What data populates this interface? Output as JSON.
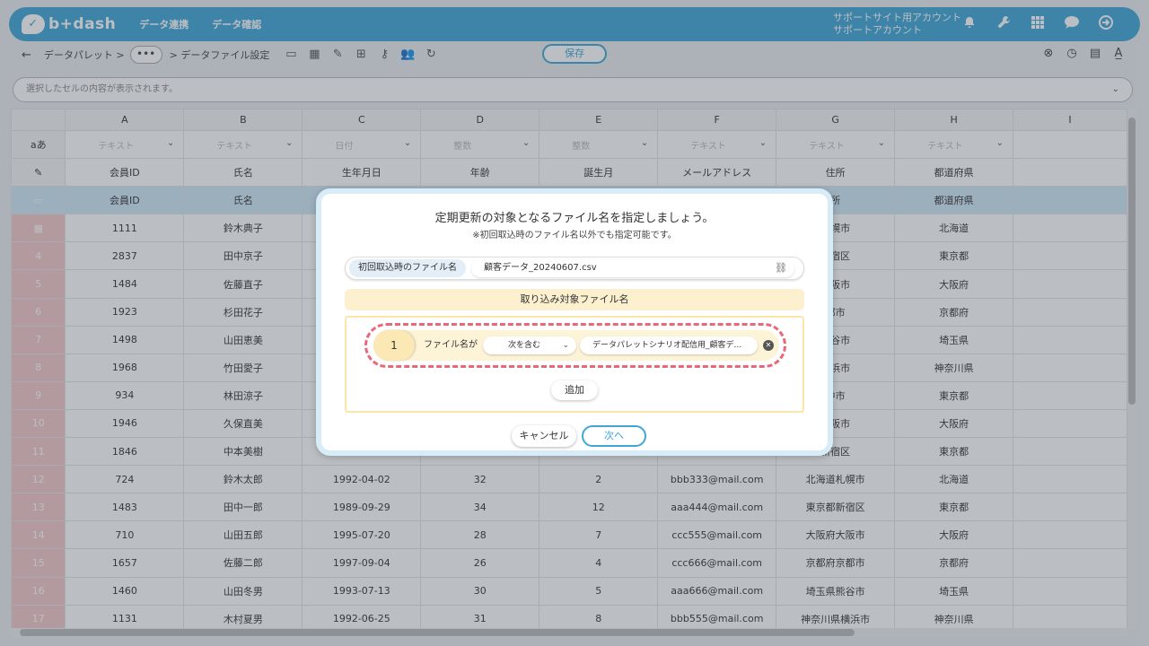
{
  "header": {
    "logo_text": "b+dash",
    "nav": [
      "データ連携",
      "データ確認"
    ],
    "account_line1": "サポートサイト用アカウント",
    "account_line2": "サポートアカウント",
    "icons": [
      "bell-icon",
      "wrench-icon",
      "grid-icon",
      "chat-icon",
      "logout-icon"
    ]
  },
  "toolbar": {
    "back": "←",
    "crumb1": "データパレット >",
    "dots": "•••",
    "crumb2": "> データファイル設定",
    "save_label": "保存"
  },
  "cellbar": {
    "placeholder": "選択したセルの内容が表示されます。"
  },
  "grid": {
    "corner_type": "aあ",
    "columns": [
      "A",
      "B",
      "C",
      "D",
      "E",
      "F",
      "G",
      "H",
      "I"
    ],
    "types": [
      "テキスト",
      "テキスト",
      "日付",
      "整数",
      "整数",
      "テキスト",
      "テキスト",
      "テキスト",
      ""
    ],
    "header_row": [
      "会員ID",
      "氏名",
      "生年月日",
      "年齢",
      "誕生月",
      "メールアドレス",
      "住所",
      "都道府県",
      ""
    ],
    "rows": [
      {
        "n": "",
        "cells": [
          "会員ID",
          "氏名",
          "",
          "",
          "",
          "",
          "所",
          "都道府県",
          ""
        ]
      },
      {
        "n": "",
        "cells": [
          "1111",
          "鈴木典子",
          "",
          "",
          "",
          "",
          "札幌市",
          "北海道",
          ""
        ]
      },
      {
        "n": "4",
        "cells": [
          "2837",
          "田中京子",
          "",
          "",
          "",
          "",
          "新宿区",
          "東京都",
          ""
        ]
      },
      {
        "n": "5",
        "cells": [
          "1484",
          "佐藤直子",
          "",
          "",
          "",
          "",
          "大阪市",
          "大阪府",
          ""
        ]
      },
      {
        "n": "6",
        "cells": [
          "1923",
          "杉田花子",
          "",
          "",
          "",
          "",
          "都市",
          "京都府",
          ""
        ]
      },
      {
        "n": "7",
        "cells": [
          "1498",
          "山田恵美",
          "",
          "",
          "",
          "",
          "熊谷市",
          "埼玉県",
          ""
        ]
      },
      {
        "n": "8",
        "cells": [
          "1968",
          "竹田愛子",
          "",
          "",
          "",
          "",
          "横浜市",
          "神奈川県",
          ""
        ]
      },
      {
        "n": "9",
        "cells": [
          "934",
          "林田涼子",
          "",
          "",
          "",
          "",
          "中市",
          "東京都",
          ""
        ]
      },
      {
        "n": "10",
        "cells": [
          "1946",
          "久保直美",
          "",
          "",
          "",
          "",
          "大阪市",
          "大阪府",
          ""
        ]
      },
      {
        "n": "11",
        "cells": [
          "1846",
          "中本美樹",
          "",
          "",
          "",
          "",
          "新宿区",
          "東京都",
          ""
        ]
      },
      {
        "n": "12",
        "cells": [
          "724",
          "鈴木太郎",
          "1992-04-02",
          "32",
          "2",
          "bbb333@mail.com",
          "北海道札幌市",
          "北海道",
          ""
        ]
      },
      {
        "n": "13",
        "cells": [
          "1483",
          "田中一郎",
          "1989-09-29",
          "34",
          "12",
          "aaa444@mail.com",
          "東京都新宿区",
          "東京都",
          ""
        ]
      },
      {
        "n": "14",
        "cells": [
          "710",
          "山田五郎",
          "1995-07-20",
          "28",
          "7",
          "ccc555@mail.com",
          "大阪府大阪市",
          "大阪府",
          ""
        ]
      },
      {
        "n": "15",
        "cells": [
          "1657",
          "佐藤二郎",
          "1997-09-04",
          "26",
          "4",
          "ccc666@mail.com",
          "京都府京都市",
          "京都府",
          ""
        ]
      },
      {
        "n": "16",
        "cells": [
          "1460",
          "山田冬男",
          "1993-07-13",
          "30",
          "5",
          "aaa666@mail.com",
          "埼玉県熊谷市",
          "埼玉県",
          ""
        ]
      },
      {
        "n": "17",
        "cells": [
          "1131",
          "木村夏男",
          "1992-06-25",
          "31",
          "8",
          "bbb555@mail.com",
          "神奈川県横浜市",
          "神奈川県",
          ""
        ]
      }
    ]
  },
  "dialog": {
    "title": "定期更新の対象となるファイル名を指定しましょう。",
    "subtitle": "※初回取込時のファイル名以外でも指定可能です。",
    "initial_label": "初回取込時のファイル名",
    "initial_value": "顧客データ_20240607.csv",
    "target_heading": "取り込み対象ファイル名",
    "condition": {
      "number": "1",
      "label": "ファイル名が",
      "operator": "次を含む",
      "value": "データパレットシナリオ配信用_顧客デ..."
    },
    "add_label": "追加",
    "cancel_label": "キャンセル",
    "next_label": "次へ"
  },
  "colors": {
    "brand": "#3fa6d8",
    "highlight_ring": "#e8687a",
    "target_bg": "#fdf0cf"
  }
}
